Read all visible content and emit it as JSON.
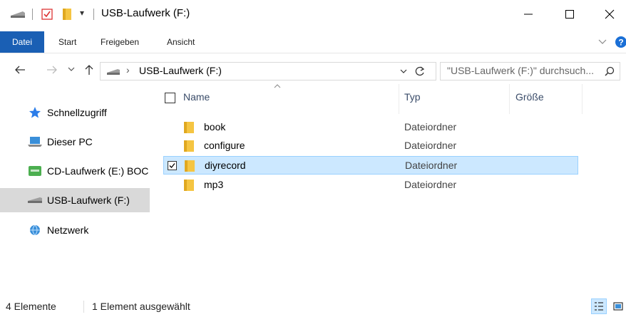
{
  "window": {
    "title": "USB-Laufwerk (F:)",
    "qat_arrow": "▾"
  },
  "ribbon": {
    "tabs": [
      "Datei",
      "Start",
      "Freigeben",
      "Ansicht"
    ]
  },
  "address": {
    "path_root": "›",
    "path": "USB-Laufwerk (F:)",
    "search_placeholder": "\"USB-Laufwerk (F:)\" durchsuch..."
  },
  "navpane": {
    "items": [
      {
        "label": "Schnellzugriff",
        "icon": "star-icon",
        "selected": false
      },
      {
        "label": "Dieser PC",
        "icon": "computer-icon",
        "selected": false
      },
      {
        "label": "CD-Laufwerk (E:) BOC",
        "icon": "cd-drive-icon",
        "selected": false
      },
      {
        "label": "USB-Laufwerk (F:)",
        "icon": "usb-drive-icon",
        "selected": true
      },
      {
        "label": "Netzwerk",
        "icon": "network-icon",
        "selected": false
      }
    ]
  },
  "filelist": {
    "columns": {
      "name": "Name",
      "type": "Typ",
      "size": "Größe"
    },
    "rows": [
      {
        "name": "book",
        "type": "Dateiordner",
        "selected": false
      },
      {
        "name": "configure",
        "type": "Dateiordner",
        "selected": false
      },
      {
        "name": "diyrecord",
        "type": "Dateiordner",
        "selected": true
      },
      {
        "name": "mp3",
        "type": "Dateiordner",
        "selected": false
      }
    ]
  },
  "statusbar": {
    "count": "4 Elemente",
    "selection": "1 Element ausgewählt"
  },
  "colors": {
    "accent": "#1a5fb4",
    "selection_bg": "#cce8ff",
    "folder": "#f5c542"
  }
}
